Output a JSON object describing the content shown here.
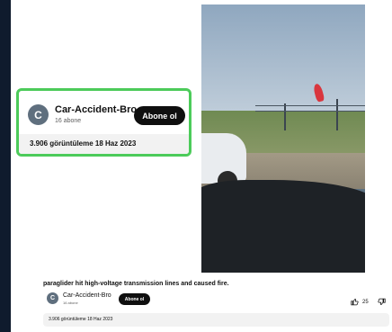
{
  "channel": {
    "avatar_letter": "C",
    "name": "Car-Accident-Bro",
    "subscribers": "16 abone",
    "subscribe_label": "Abone ol"
  },
  "video": {
    "title": "paraglider hit high-voltage transmission lines and caused fire.",
    "stats": "3.906 görüntüleme  18 Haz 2023",
    "likes": "25"
  },
  "colors": {
    "highlight_border": "#4ccb5a",
    "subscribe_button": "#0f0f0f",
    "avatar": "#5f6f7e"
  },
  "icons": [
    "thumbs-up-icon",
    "thumbs-down-icon"
  ]
}
